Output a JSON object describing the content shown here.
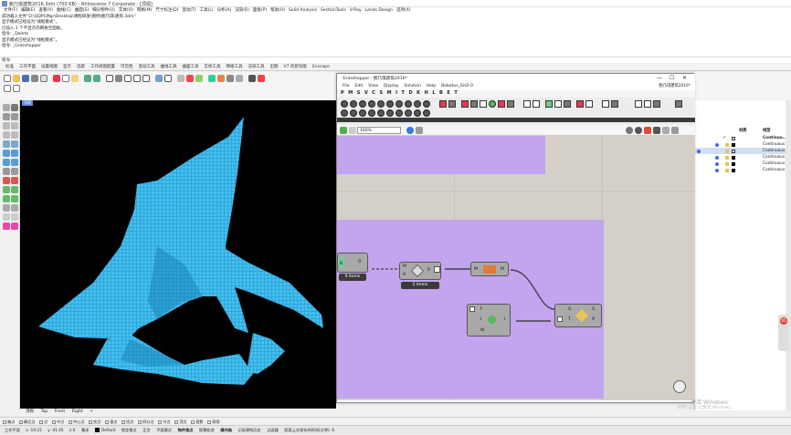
{
  "app": {
    "title": "鲍乃琪建筑2016.3dm (700 KB) - Rhinoceros 7 Corporate - [顶视]"
  },
  "menu": [
    "文件(F)",
    "编辑(E)",
    "查看(V)",
    "曲线(C)",
    "曲面(S)",
    "细分物件(U)",
    "实体(O)",
    "网格(M)",
    "尺寸标注(D)",
    "变动(T)",
    "工具(L)",
    "分析(A)",
    "渲染(R)",
    "面板(P)",
    "帮助(H)",
    "Solid Analysis",
    "SectionTools",
    "V-Ray",
    "Lands Design",
    "选项(X)"
  ],
  "command_history": [
    "成功载入文件“D:\\QQPCMgr\\Desktop\\课程研发\\图例\\鲍乃琪\\建筑.3dm”",
    "显示模式已经设为“线框模式”。",
    "已加入 1 个不显示的网格至面板。",
    "指令: _Delete",
    "显示模式已经设为“线框模式”。",
    "指令: _Grasshopper"
  ],
  "command_prompt": "指令:",
  "ribbon_tabs": [
    "标准",
    "工作平面",
    "设置视图",
    "显示",
    "选取",
    "工作视窗配置",
    "可见性",
    "变动工具",
    "曲线工具",
    "曲面工具",
    "实体工具",
    "网格工具",
    "渲染工具",
    "出图",
    "V7 的新功能",
    "Enscape"
  ],
  "viewport": {
    "label": "顶视"
  },
  "view_tabs": [
    "顶视",
    "Top",
    "Front",
    "Right",
    "+"
  ],
  "osnaps": [
    "端点",
    "最近点",
    "点",
    "中点",
    "中心点",
    "交点",
    "垂点",
    "切点",
    "四分点",
    "节点",
    "顶点",
    "投影",
    "停用"
  ],
  "status": {
    "cplane": "工作平面",
    "x": "x -19.23",
    "y": "y -41.45",
    "z": "z 0",
    "units": "毫米",
    "layer": "Default",
    "items": [
      "锁定格点",
      "正交",
      "平面模式",
      "物件锁点",
      "智慧轨迹",
      "操作轴",
      "记录建构历史",
      "过滤器",
      "距离上次保存的时间(分钟): 6"
    ]
  },
  "layers": {
    "header": [
      "材质",
      "线型"
    ],
    "rows": [
      {
        "linetype": "Continuo..."
      },
      {
        "linetype": "Continuous"
      },
      {
        "linetype": "Continuous"
      },
      {
        "linetype": "Continuous"
      },
      {
        "linetype": "Continuous"
      },
      {
        "linetype": "Continuous"
      }
    ]
  },
  "side_button": {
    "label": "65"
  },
  "grasshopper": {
    "title": "Grasshopper - 鲍乃琪建筑2016*",
    "file_label": "鲍乃琪建筑2016*",
    "menu": [
      "File",
      "Edit",
      "View",
      "Display",
      "Solution",
      "Help",
      "Bobatus_GH2.0"
    ],
    "tabs": [
      "Params",
      "Maths",
      "Sets",
      "Vector",
      "Curve",
      "Surface",
      "Mesh",
      "Intersect",
      "Transform",
      "Display",
      "Kangaroo",
      "Human",
      "LunchBox"
    ],
    "zoom": "160%",
    "components": {
      "brep": {
        "inputs": [
          "B"
        ],
        "output": "O",
        "plate": "9 items"
      },
      "offset": {
        "inputs": [
          "M",
          "A"
        ],
        "output": "R",
        "plate": "2 items"
      },
      "mesh": {
        "input": "M",
        "output": "M"
      },
      "box": {
        "inputs": [
          "L",
          "I",
          "W"
        ],
        "output": "I"
      },
      "gate": {
        "inputs": [
          "G",
          "T"
        ],
        "outputs": [
          "G",
          "X"
        ]
      }
    }
  },
  "watermark": {
    "line1": "激活 Windows",
    "line2": "转到“设置”以激活 Windows。"
  },
  "colors": {
    "viewport_bg": "#000000",
    "shape": "#39b4e6",
    "group": "#c3a4ee",
    "canvas": "#d4d0c8"
  }
}
